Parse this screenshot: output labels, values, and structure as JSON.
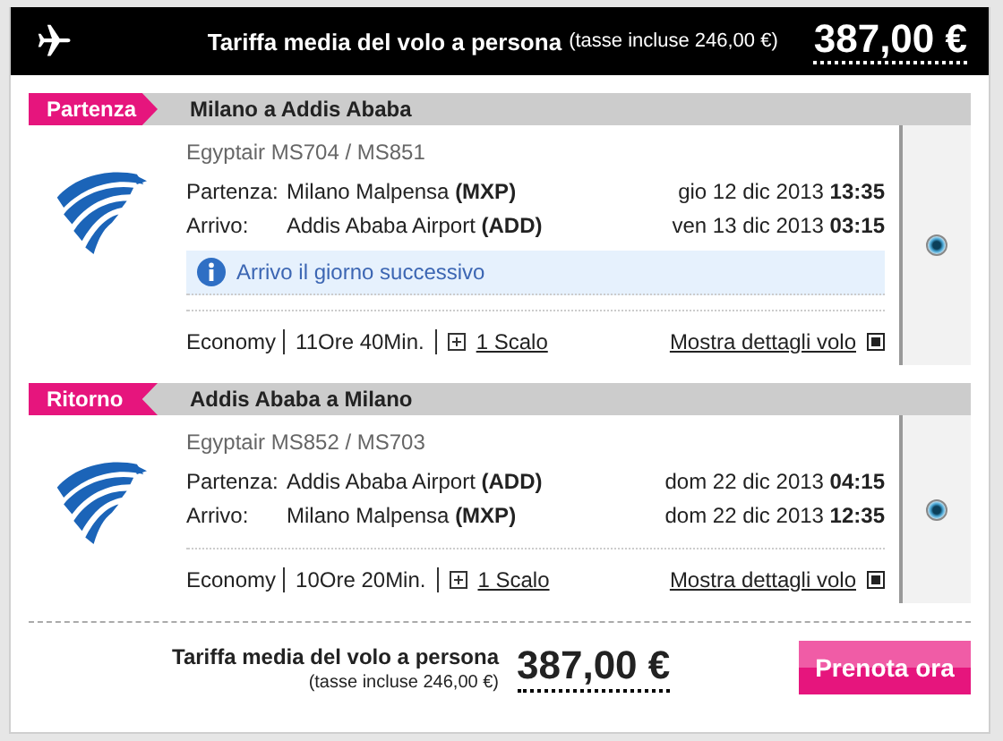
{
  "header": {
    "fare_label": "Tariffa media del volo a persona",
    "taxes": "(tasse incluse 246,00 €)",
    "price": "387,00 €"
  },
  "legs": [
    {
      "tag": "Partenza",
      "kind": "outbound",
      "route": "Milano a Addis Ababa",
      "carrier": "Egyptair MS704 / MS851",
      "departure": {
        "label": "Partenza:",
        "place": "Milano Malpensa",
        "code": "(MXP)",
        "date": "gio 12 dic 2013",
        "time": "13:35"
      },
      "arrival": {
        "label": "Arrivo:",
        "place": "Addis Ababa Airport",
        "code": "(ADD)",
        "date": "ven 13 dic 2013",
        "time": "03:15"
      },
      "note": "Arrivo il giorno successivo",
      "cabin": "Economy",
      "duration": "11Ore 40Min.",
      "stops": "1 Scalo",
      "details": "Mostra dettagli volo",
      "selected": true
    },
    {
      "tag": "Ritorno",
      "kind": "return",
      "route": "Addis Ababa a Milano",
      "carrier": "Egyptair MS852 / MS703",
      "departure": {
        "label": "Partenza:",
        "place": "Addis Ababa Airport",
        "code": "(ADD)",
        "date": "dom 22 dic 2013",
        "time": "04:15"
      },
      "arrival": {
        "label": "Arrivo:",
        "place": "Milano Malpensa",
        "code": "(MXP)",
        "date": "dom 22 dic 2013",
        "time": "12:35"
      },
      "cabin": "Economy",
      "duration": "10Ore 20Min.",
      "stops": "1 Scalo",
      "details": "Mostra dettagli volo",
      "selected": true
    }
  ],
  "footer": {
    "fare_label": "Tariffa media del volo a persona",
    "taxes": "(tasse incluse 246,00 €)",
    "price": "387,00 €",
    "book_button": "Prenota ora"
  }
}
